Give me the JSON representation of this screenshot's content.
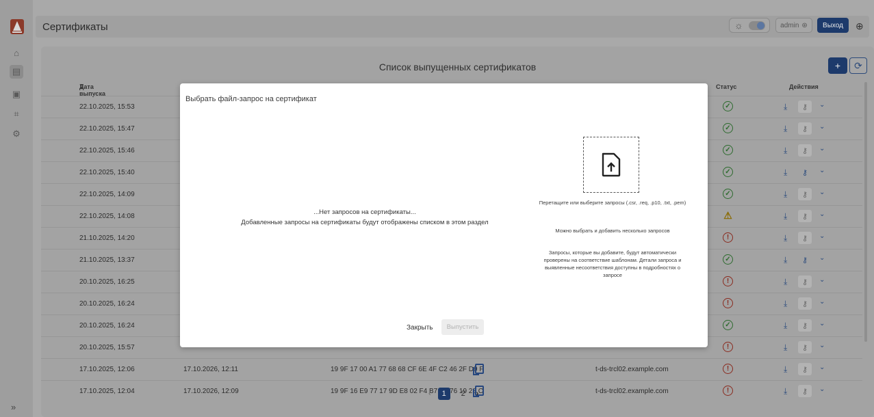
{
  "header": {
    "title": "Сертификаты",
    "user_label": "admin",
    "logout_label": "Выход"
  },
  "sidebar": {
    "items": [
      {
        "icon": "home-icon"
      },
      {
        "icon": "certificate-list-icon",
        "active": true
      },
      {
        "icon": "certificate-request-icon"
      },
      {
        "icon": "scan-icon"
      },
      {
        "icon": "settings-icon"
      }
    ],
    "expand_label": "»"
  },
  "list": {
    "title": "Список выпущенных сертификатов",
    "add_label": "+",
    "columns": {
      "issue_date": "Дата выпуска",
      "status": "Статус",
      "actions": "Действия"
    },
    "rows": [
      {
        "issue": "22.10.2025, 15:53",
        "status": "ok",
        "key_active": false
      },
      {
        "issue": "22.10.2025, 15:47",
        "status": "ok",
        "key_active": false
      },
      {
        "issue": "22.10.2025, 15:46",
        "status": "ok",
        "key_active": false
      },
      {
        "issue": "22.10.2025, 15:40",
        "status": "ok",
        "key_active": true
      },
      {
        "issue": "22.10.2025, 14:09",
        "status": "ok",
        "key_active": false
      },
      {
        "issue": "22.10.2025, 14:08",
        "status": "warn",
        "key_active": false
      },
      {
        "issue": "21.10.2025, 14:20",
        "status": "err",
        "key_active": false
      },
      {
        "issue": "21.10.2025, 13:37",
        "status": "ok",
        "key_active": true
      },
      {
        "issue": "20.10.2025, 16:25",
        "status": "err",
        "key_active": false
      },
      {
        "issue": "20.10.2025, 16:24",
        "status": "err",
        "key_active": false
      },
      {
        "issue": "20.10.2025, 16:24",
        "status": "ok",
        "key_active": false
      },
      {
        "issue": "20.10.2025, 15:57",
        "status": "err",
        "key_active": false
      },
      {
        "issue": "17.10.2025, 12:06",
        "expires": "17.10.2026, 12:11",
        "serial": "19 9F 17 00 A1 77 68 68 CF 6E 4F C2 46 2F D9 F",
        "subject": "t-ds-trcl02.example.com",
        "status": "err",
        "key_active": false
      },
      {
        "issue": "17.10.2025, 12:04",
        "expires": "17.10.2026, 12:09",
        "serial": "19 9F 16 E9 77 17 9D E8 02 F4 B7 E1 76 19 28 C",
        "subject": "t-ds-trcl02.example.com",
        "status": "err",
        "key_active": false
      }
    ],
    "pagination": {
      "current": "1",
      "next": "2"
    }
  },
  "modal": {
    "title": "Выбрать файл-запрос на сертификат",
    "empty_line1": "...Нет запросов на сертификаты...",
    "empty_line2": "Добавленные запросы на сертификаты будут отображены списком в этом раздел",
    "drop_hint": "Перетащите или выберите запросы (.csr, .req, .p10, .txt, .pem)",
    "multi_hint": "Можно выбрать и добавить несколько запросов",
    "check_hint": "Запросы, которые вы добавите, будут автоматически проверены на соответствие шаблонам. Детали запроса и выявленные несоответствия доступны в подробностях о запросе",
    "close_label": "Закрыть",
    "issue_label": "Выпустить"
  }
}
